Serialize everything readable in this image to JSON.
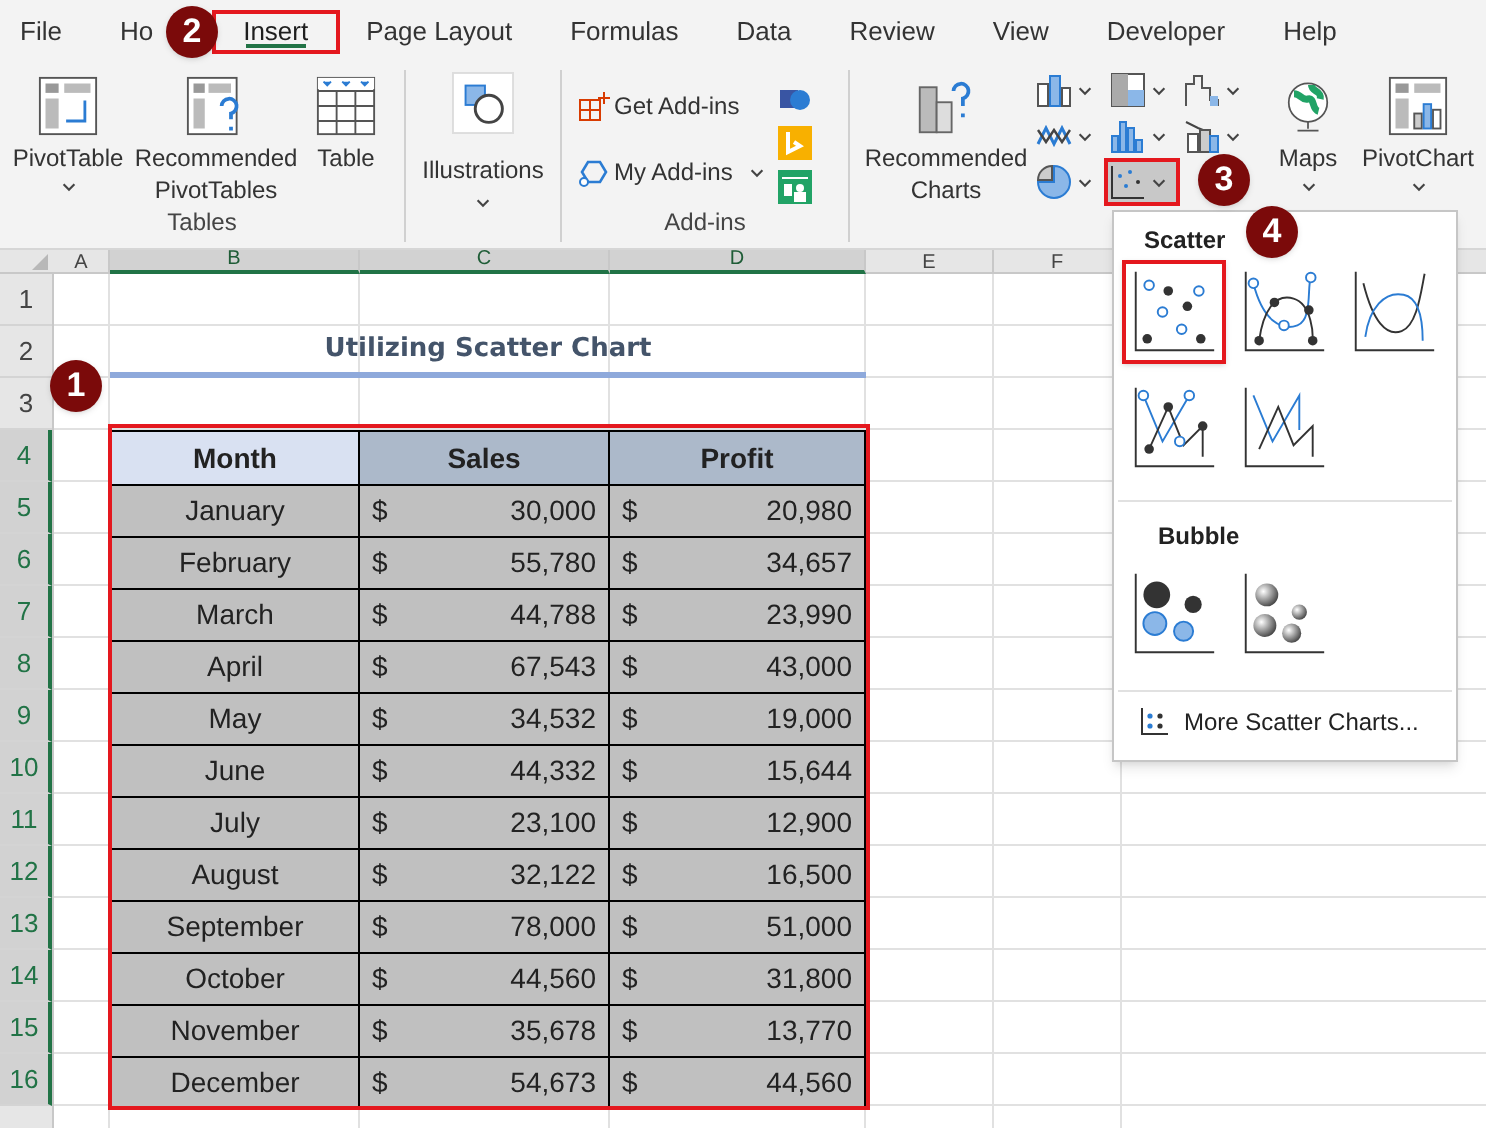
{
  "tabs": [
    {
      "label": "File",
      "selected": false
    },
    {
      "label": "Ho",
      "selected": false
    },
    {
      "label": "Insert",
      "selected": true
    },
    {
      "label": "Page Layout",
      "selected": false
    },
    {
      "label": "Formulas",
      "selected": false
    },
    {
      "label": "Data",
      "selected": false
    },
    {
      "label": "Review",
      "selected": false
    },
    {
      "label": "View",
      "selected": false
    },
    {
      "label": "Developer",
      "selected": false
    },
    {
      "label": "Help",
      "selected": false
    }
  ],
  "ribbon": {
    "tables_group": {
      "label": "Tables",
      "buttons": [
        "PivotTable",
        "Recommended PivotTables",
        "Table"
      ]
    },
    "illustrations_button": "Illustrations",
    "addins_group": {
      "label": "Add-ins",
      "buttons": [
        "Get Add-ins",
        "My Add-ins"
      ]
    },
    "charts_group": {
      "recommended_charts": "Recommended Charts",
      "chart_buttons": [
        {
          "selected": false
        },
        {
          "selected": false
        },
        {
          "selected": false
        },
        {
          "selected": false
        },
        {
          "selected": false
        },
        {
          "selected": false
        },
        {
          "selected": false
        },
        {
          "selected": true
        }
      ],
      "maps": "Maps",
      "pivot_chart": "PivotChart"
    }
  },
  "sheet": {
    "column_headers": [
      {
        "label": "A",
        "selected": false
      },
      {
        "label": "B",
        "selected": true
      },
      {
        "label": "C",
        "selected": true
      },
      {
        "label": "D",
        "selected": true
      },
      {
        "label": "E",
        "selected": false
      },
      {
        "label": "F",
        "selected": false
      }
    ],
    "row_headers": [
      {
        "label": "1",
        "selected": false
      },
      {
        "label": "2",
        "selected": false
      },
      {
        "label": "3",
        "selected": false
      },
      {
        "label": "4",
        "selected": true
      },
      {
        "label": "5",
        "selected": true
      },
      {
        "label": "6",
        "selected": true
      },
      {
        "label": "7",
        "selected": true
      },
      {
        "label": "8",
        "selected": true
      },
      {
        "label": "9",
        "selected": true
      },
      {
        "label": "10",
        "selected": true
      },
      {
        "label": "11",
        "selected": true
      },
      {
        "label": "12",
        "selected": true
      },
      {
        "label": "13",
        "selected": true
      },
      {
        "label": "14",
        "selected": true
      },
      {
        "label": "15",
        "selected": true
      },
      {
        "label": "16",
        "selected": true
      }
    ],
    "title": "Utilizing Scatter Chart",
    "table": {
      "columns": [
        "Month",
        "Sales",
        "Profit"
      ],
      "rows": [
        {
          "month": "January",
          "sales_currency": "$",
          "sales": "30,000",
          "profit_currency": "$",
          "profit": "20,980"
        },
        {
          "month": "February",
          "sales_currency": "$",
          "sales": "55,780",
          "profit_currency": "$",
          "profit": "34,657"
        },
        {
          "month": "March",
          "sales_currency": "$",
          "sales": "44,788",
          "profit_currency": "$",
          "profit": "23,990"
        },
        {
          "month": "April",
          "sales_currency": "$",
          "sales": "67,543",
          "profit_currency": "$",
          "profit": "43,000"
        },
        {
          "month": "May",
          "sales_currency": "$",
          "sales": "34,532",
          "profit_currency": "$",
          "profit": "19,000"
        },
        {
          "month": "June",
          "sales_currency": "$",
          "sales": "44,332",
          "profit_currency": "$",
          "profit": "15,644"
        },
        {
          "month": "July",
          "sales_currency": "$",
          "sales": "23,100",
          "profit_currency": "$",
          "profit": "12,900"
        },
        {
          "month": "August",
          "sales_currency": "$",
          "sales": "32,122",
          "profit_currency": "$",
          "profit": "16,500"
        },
        {
          "month": "September",
          "sales_currency": "$",
          "sales": "78,000",
          "profit_currency": "$",
          "profit": "51,000"
        },
        {
          "month": "October",
          "sales_currency": "$",
          "sales": "44,560",
          "profit_currency": "$",
          "profit": "31,800"
        },
        {
          "month": "November",
          "sales_currency": "$",
          "sales": "35,678",
          "profit_currency": "$",
          "profit": "13,770"
        },
        {
          "month": "December",
          "sales_currency": "$",
          "sales": "54,673",
          "profit_currency": "$",
          "profit": "44,560"
        }
      ]
    }
  },
  "scatter_menu": {
    "scatter_heading": "Scatter",
    "scatter_options": [
      {
        "selected": true
      },
      {
        "selected": false
      },
      {
        "selected": false
      },
      {
        "selected": false
      },
      {
        "selected": false
      }
    ],
    "bubble_heading": "Bubble",
    "bubble_options": [
      {
        "selected": false
      },
      {
        "selected": false
      }
    ],
    "more_link": "More Scatter Charts..."
  },
  "step_markers": [
    "1",
    "2",
    "3",
    "4"
  ]
}
